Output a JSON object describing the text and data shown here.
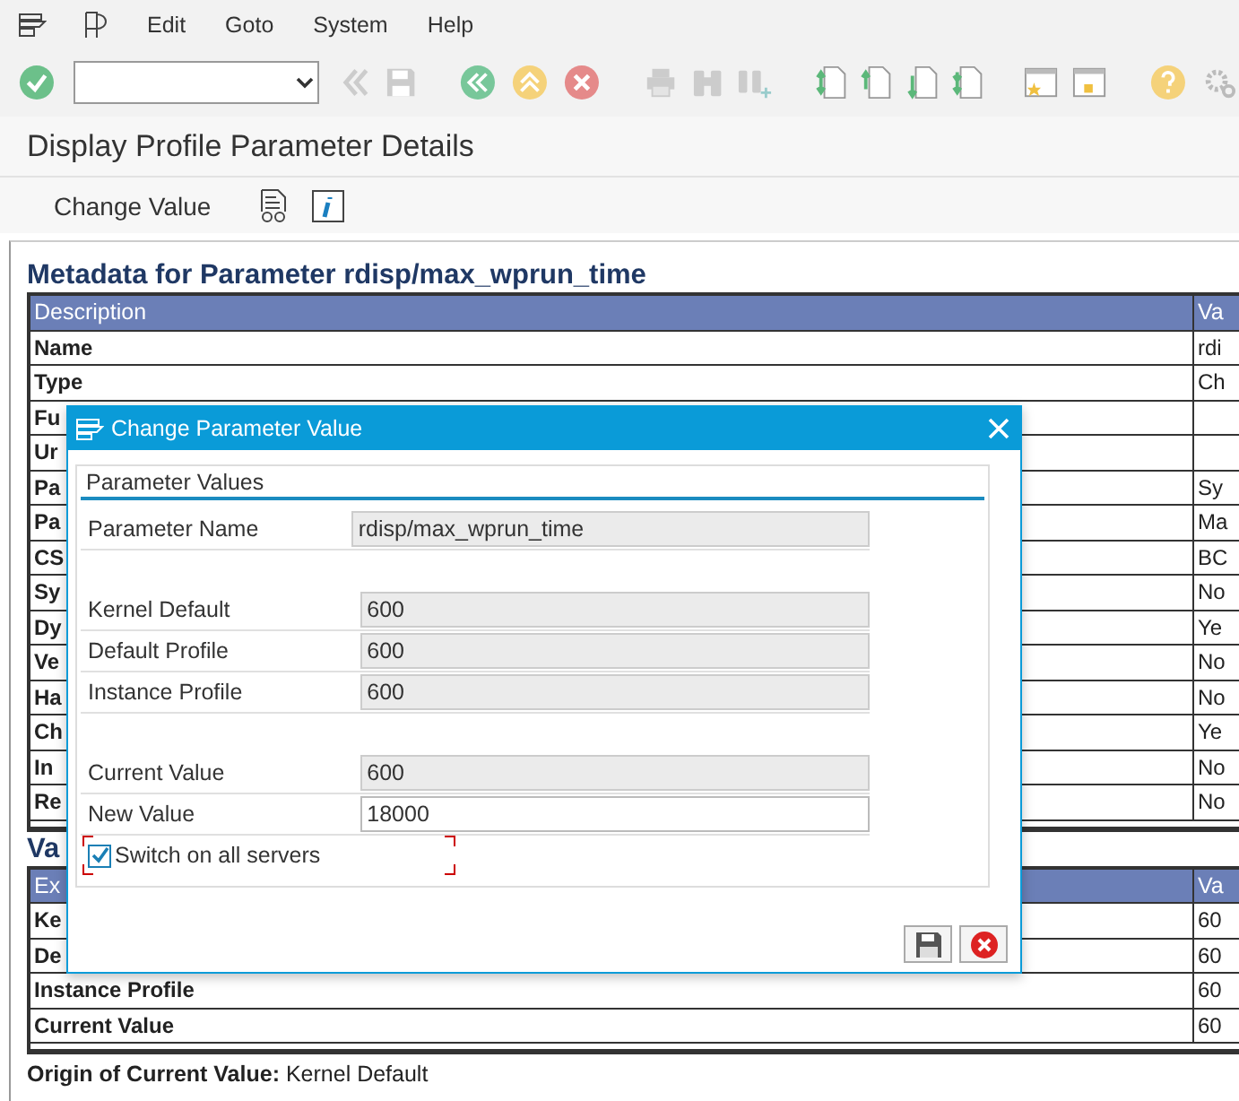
{
  "menu_bar": {
    "items": [
      {
        "label": "Edit"
      },
      {
        "label": "Goto"
      },
      {
        "label": "System"
      },
      {
        "label": "Help"
      }
    ]
  },
  "screen_title": "Display Profile Parameter Details",
  "app_toolbar": {
    "button": "Change Value"
  },
  "metadata": {
    "title": "Metadata for Parameter rdisp/max_wprun_time",
    "columns": [
      "Description",
      "Va"
    ],
    "rows": [
      {
        "label": "Name",
        "value": "rdi"
      },
      {
        "label": "Type",
        "value": "Ch"
      },
      {
        "label": "Fu"
      },
      {
        "label": "Ur"
      },
      {
        "label": "Pa",
        "value": "Sy"
      },
      {
        "label": "Pa",
        "value": "Ma"
      },
      {
        "label": "CS",
        "value": "BC"
      },
      {
        "label": "Sy",
        "value": "No"
      },
      {
        "label": "Dy",
        "value": "Ye"
      },
      {
        "label": "Ve",
        "value": "No"
      },
      {
        "label": "Ha",
        "value": "No"
      },
      {
        "label": "Ch",
        "value": "Ye"
      },
      {
        "label": "In",
        "value": "No"
      },
      {
        "label": "Re",
        "value": "No"
      }
    ]
  },
  "values": {
    "title": "Va",
    "columns": [
      "Ex",
      "Va"
    ],
    "rows": [
      {
        "label": "Ke",
        "value": "60"
      },
      {
        "label": "De",
        "value": "60"
      },
      {
        "label": "Instance Profile",
        "value": "60"
      },
      {
        "label": "Current Value",
        "value": "60"
      }
    ]
  },
  "origin": "**Origin of Current Value:** Kernel Default",
  "dialog": {
    "title": "Change Parameter Value",
    "group_title": "Parameter Values",
    "groups": [
      [
        {
          "label": "Parameter Name",
          "value": "rdisp/max_wprun_time",
          "editable": false
        }
      ],
      [
        {
          "label": "Kernel Default",
          "value": "600",
          "editable": false
        },
        {
          "label": "Default Profile",
          "value": "600",
          "editable": false
        },
        {
          "label": "Instance Profile",
          "value": "600",
          "editable": false
        }
      ],
      [
        {
          "label": "Current Value",
          "value": "600",
          "editable": false
        },
        {
          "label": "New Value",
          "value": "18000",
          "editable": true
        }
      ]
    ],
    "checkbox": {
      "label": "Switch on all servers",
      "checked": true,
      "focused": true
    }
  }
}
